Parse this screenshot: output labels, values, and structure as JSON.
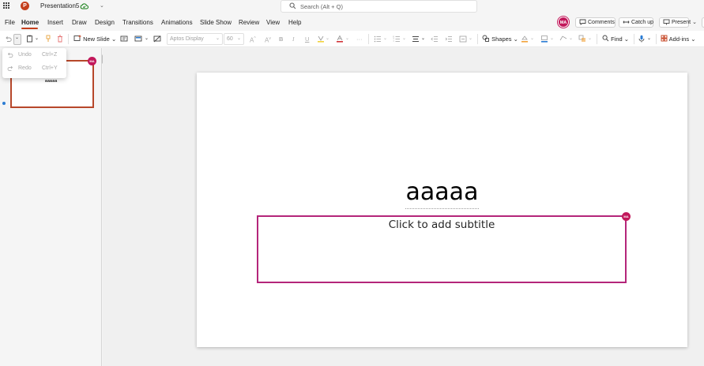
{
  "app": {
    "doc_title": "Presentation5",
    "search_placeholder": "Search (Alt + Q)",
    "app_icon": "powerpoint-logo",
    "cloud_icon": "cloud-saved-icon",
    "brand_color": "#c43e1c"
  },
  "tabs": [
    "File",
    "Home",
    "Insert",
    "Draw",
    "Design",
    "Transitions",
    "Animations",
    "Slide Show",
    "Review",
    "View",
    "Help"
  ],
  "active_tab": "Home",
  "user": {
    "initials": "MA",
    "color": "#c2185b"
  },
  "top_buttons": {
    "comments": "Comments",
    "catch_up": "Catch up",
    "present": "Present"
  },
  "ribbon": {
    "new_slide": "New Slide",
    "font_name": "Aptos Display",
    "font_size": "60",
    "bold": "B",
    "italic": "I",
    "underline": "U",
    "shapes": "Shapes",
    "find": "Find",
    "addins": "Add-ins"
  },
  "undo_menu": {
    "undo_label": "Undo",
    "undo_shortcut": "Ctrl+Z",
    "redo_label": "Redo",
    "redo_shortcut": "Ctrl+Y"
  },
  "thumbnail": {
    "text": "aaaaa",
    "initials": "MA"
  },
  "slide": {
    "title": "aaaaa",
    "subtitle_placeholder": "Click to add subtitle",
    "subtitle_border_color": "#b4257a",
    "editor_initials": "MA"
  }
}
